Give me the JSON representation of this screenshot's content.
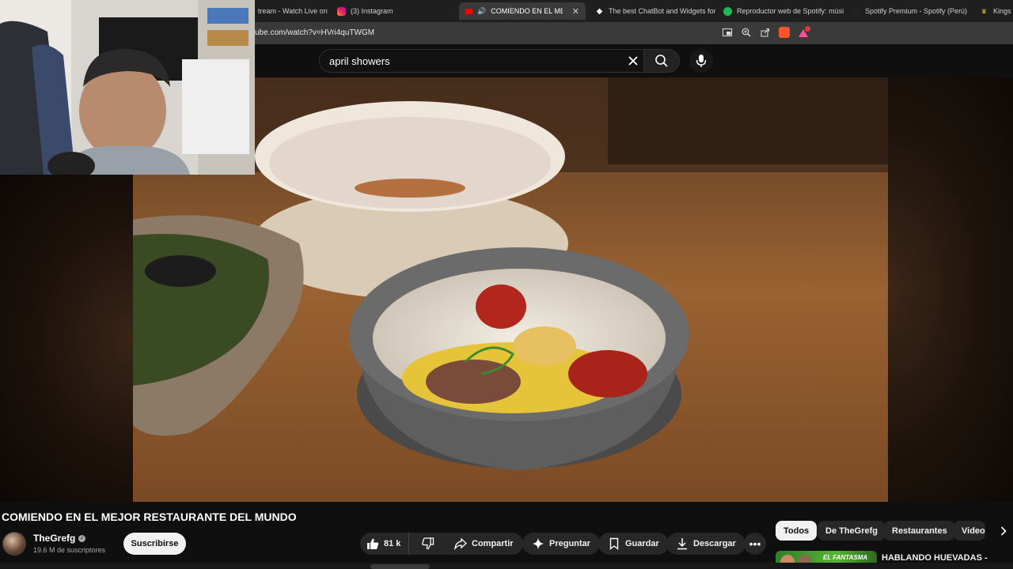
{
  "browser": {
    "tabs": [
      {
        "label": "tream - Watch Live on",
        "icon": "twitch-icon",
        "active": false
      },
      {
        "label": "(3) Instagram",
        "icon": "instagram-icon",
        "active": false
      },
      {
        "label": "COMIENDO EN EL MEJOR R",
        "icon": "youtube-icon",
        "active": true
      },
      {
        "label": "The best ChatBot and Widgets for",
        "icon": "streamelements-icon",
        "active": false
      },
      {
        "label": "Reproductor web de Spotify: músi",
        "icon": "spotify-icon",
        "active": false
      },
      {
        "label": "Spotify Premium - Spotify (Perú)",
        "icon": "spotify-icon",
        "active": false
      },
      {
        "label": "Kings V",
        "icon": "crown-icon",
        "active": false
      }
    ],
    "url": "ube.com/watch?v=HVri4quTWGM"
  },
  "search": {
    "query": "april showers"
  },
  "video": {
    "title": "COMIENDO EN EL MEJOR RESTAURANTE DEL MUNDO",
    "channel": "TheGrefg",
    "subscribers": "19.6 M de suscriptores",
    "subscribe_label": "Suscribirse",
    "likes": "81 k",
    "share_label": "Compartir",
    "ask_label": "Preguntar",
    "save_label": "Guardar",
    "download_label": "Descargar"
  },
  "chips": [
    "Todos",
    "De TheGrefg",
    "Restaurantes",
    "Videos"
  ],
  "recommendation": {
    "thumb_text": "EL FANTASMA",
    "title": "HABLANDO HUEVADAS - Undécima Temporada [El"
  },
  "colors": {
    "page_bg": "#0f0f0f",
    "accent": "#ff0000",
    "pill_bg": "#272727"
  }
}
